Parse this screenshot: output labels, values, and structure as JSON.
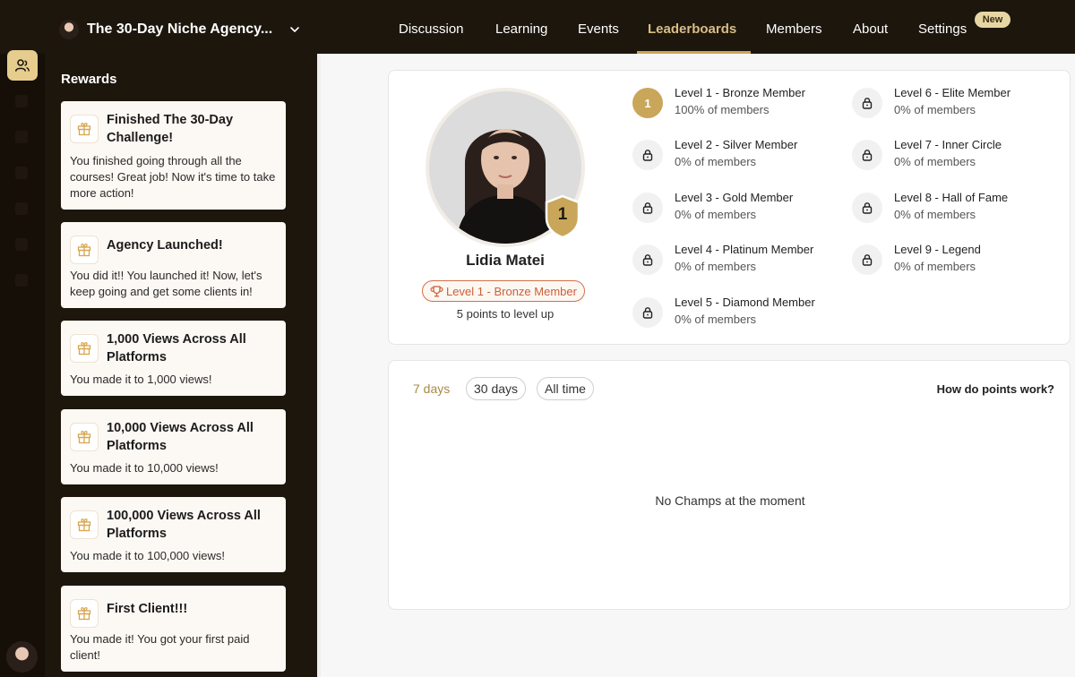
{
  "header": {
    "community_title": "The 30-Day Niche Agency...",
    "tabs": [
      {
        "label": "Discussion"
      },
      {
        "label": "Learning"
      },
      {
        "label": "Events"
      },
      {
        "label": "Leaderboards",
        "active": true
      },
      {
        "label": "Members"
      },
      {
        "label": "About"
      },
      {
        "label": "Settings"
      }
    ],
    "new_badge": "New"
  },
  "sidebar": {
    "title": "Rewards",
    "rewards": [
      {
        "title": "Finished The 30-Day Challenge!",
        "desc": "You finished going through all the courses! Great job! Now it's time to take more action!"
      },
      {
        "title": "Agency Launched!",
        "desc": "You did it!! You launched it! Now, let's keep going and get some clients in!"
      },
      {
        "title": "1,000 Views Across All Platforms",
        "desc": "You made it to 1,000 views!"
      },
      {
        "title": "10,000 Views Across All Platforms",
        "desc": "You made it to 10,000 views!"
      },
      {
        "title": "100,000 Views Across All Platforms",
        "desc": "You made it to 100,000 views!"
      },
      {
        "title": "First Client!!!",
        "desc": "You made it! You got your first paid client!"
      }
    ]
  },
  "profile": {
    "name": "Lidia Matei",
    "badge_level": "1",
    "level_label": "Level 1 - Bronze Member",
    "points_to_level_up": "5 points to level up"
  },
  "levels": [
    {
      "name": "Level 1 - Bronze Member",
      "pct": "100% of members",
      "marker": "1",
      "unlocked": true
    },
    {
      "name": "Level 2 - Silver Member",
      "pct": "0% of members",
      "unlocked": false
    },
    {
      "name": "Level 3 - Gold Member",
      "pct": "0% of members",
      "unlocked": false
    },
    {
      "name": "Level 4 - Platinum Member",
      "pct": "0% of members",
      "unlocked": false
    },
    {
      "name": "Level 5 - Diamond Member",
      "pct": "0% of members",
      "unlocked": false
    },
    {
      "name": "Level 6 - Elite Member",
      "pct": "0% of members",
      "unlocked": false
    },
    {
      "name": "Level 7 - Inner Circle",
      "pct": "0% of members",
      "unlocked": false
    },
    {
      "name": "Level 8 - Hall of Fame",
      "pct": "0% of members",
      "unlocked": false
    },
    {
      "name": "Level 9 - Legend",
      "pct": "0% of members",
      "unlocked": false
    }
  ],
  "leaderboard": {
    "filters": [
      {
        "label": "7 days",
        "active": true
      },
      {
        "label": "30 days"
      },
      {
        "label": "All time"
      }
    ],
    "help_link": "How do points work?",
    "empty_message": "No Champs at the moment"
  },
  "colors": {
    "topbar": "#1c160d",
    "accent_gold": "#c9a65a",
    "level_pill": "#d46f47",
    "card_bg": "#fcf8f3"
  },
  "icons": {
    "community_chevron": "chevron-down-icon",
    "rail_active": "members-icon",
    "reward_card": "gift-icon",
    "level_locked": "lock-icon",
    "level_pill": "trophy-icon",
    "profile_badge": "shield-badge-icon"
  }
}
